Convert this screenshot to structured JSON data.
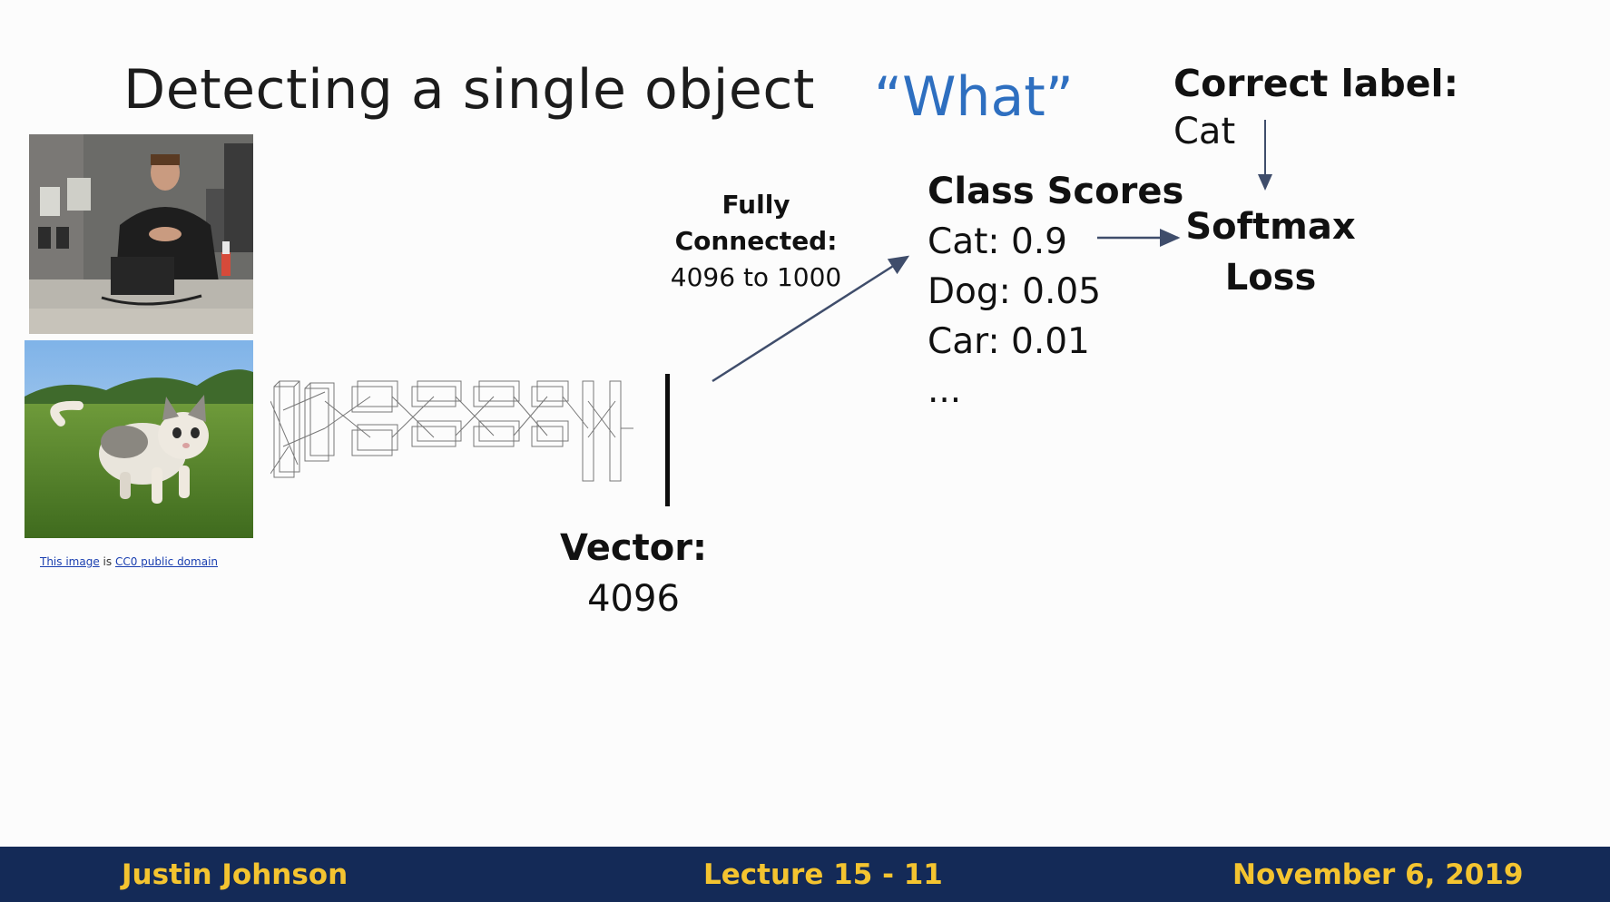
{
  "slide": {
    "title": "Detecting a single object",
    "what": "“What”",
    "correct_label_heading": "Correct label:",
    "correct_label_value": "Cat",
    "class_scores_heading": "Class Scores",
    "scores": [
      "Cat: 0.9",
      "Dog: 0.05",
      "Car: 0.01",
      "..."
    ],
    "softmax_line1": "Softmax",
    "softmax_line2": "Loss",
    "fc_line1": "Fully",
    "fc_line2": "Connected:",
    "fc_line3": "4096 to 1000",
    "vector_line1": "Vector:",
    "vector_line2": "4096",
    "credit_link1": "This image",
    "credit_mid": " is ",
    "credit_link2": "CC0 public domain"
  },
  "footer": {
    "author": "Justin Johnson",
    "lecture": "Lecture 15 - 11",
    "date": "November 6, 2019"
  },
  "colors": {
    "accent": "#2e6fc0",
    "footer_bg": "#142a57",
    "footer_text": "#f4c430"
  },
  "icons": [
    "speaker-video-thumbnail",
    "kitten-photo",
    "cnn-architecture-diagram"
  ]
}
